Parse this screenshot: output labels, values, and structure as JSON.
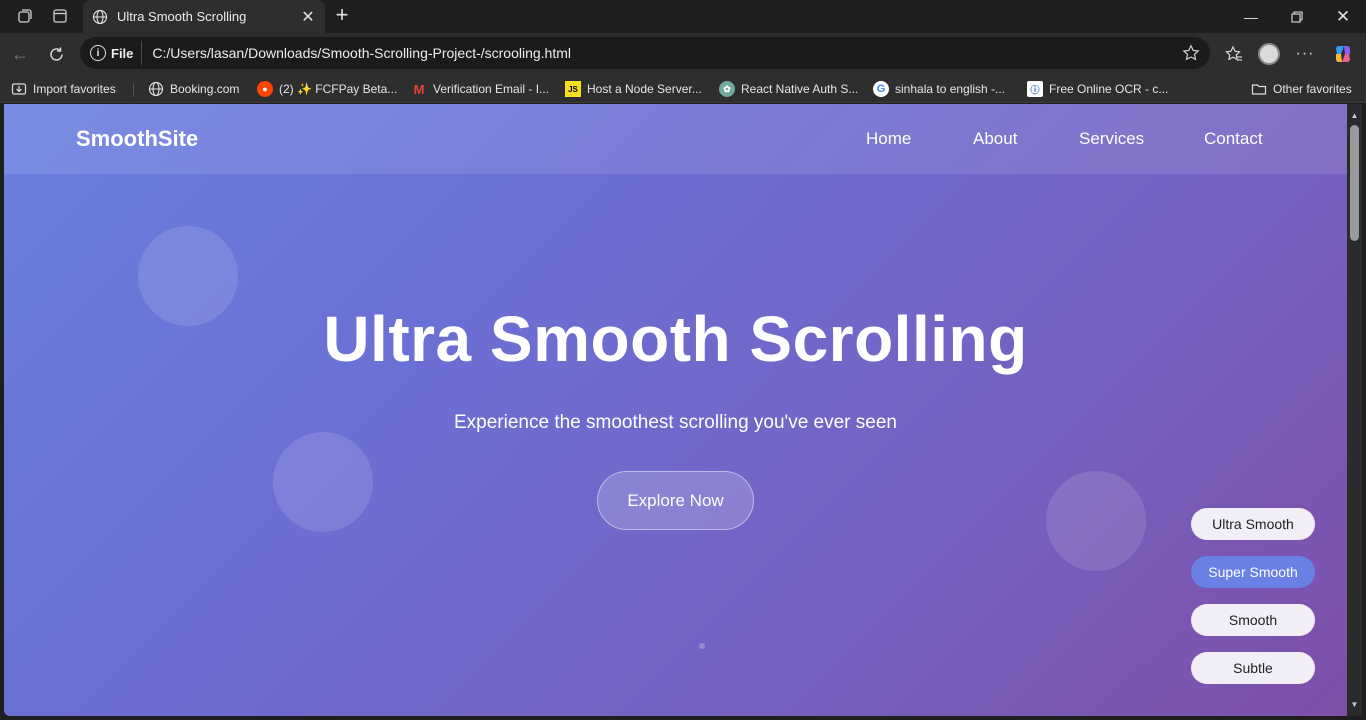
{
  "browser": {
    "tab_title": "Ultra Smooth Scrolling",
    "file_label": "File",
    "url": "C:/Users/lasan/Downloads/Smooth-Scrolling-Project-/scrooling.html"
  },
  "bookmarks": {
    "items": [
      {
        "label": "Import favorites",
        "icon": "import-icon"
      },
      {
        "label": "Booking.com",
        "icon": "globe-icon"
      },
      {
        "label": "(2) ✨ FCFPay Beta...",
        "icon": "reddit-icon"
      },
      {
        "label": "Verification Email - I...",
        "icon": "gmail-icon"
      },
      {
        "label": "Host a Node Server...",
        "icon": "js-icon"
      },
      {
        "label": "React Native Auth S...",
        "icon": "chatgpt-icon"
      },
      {
        "label": "sinhala to english -...",
        "icon": "google-icon"
      },
      {
        "label": "Free Online OCR - c...",
        "icon": "ocr-icon"
      }
    ],
    "other": "Other favorites"
  },
  "site": {
    "logo": "SmoothSite",
    "nav": [
      "Home",
      "About",
      "Services",
      "Contact"
    ],
    "hero_title": "Ultra Smooth Scrolling",
    "hero_subtitle": "Experience the smoothest scrolling you've ever seen",
    "cta": "Explore Now",
    "scroll_options": [
      "Ultra Smooth",
      "Super Smooth",
      "Smooth",
      "Subtle"
    ],
    "active_option": "Super Smooth"
  },
  "colors": {
    "gradient_start": "#6a7fe0",
    "gradient_end": "#7d4fa8",
    "active_option": "#6a80e4"
  }
}
